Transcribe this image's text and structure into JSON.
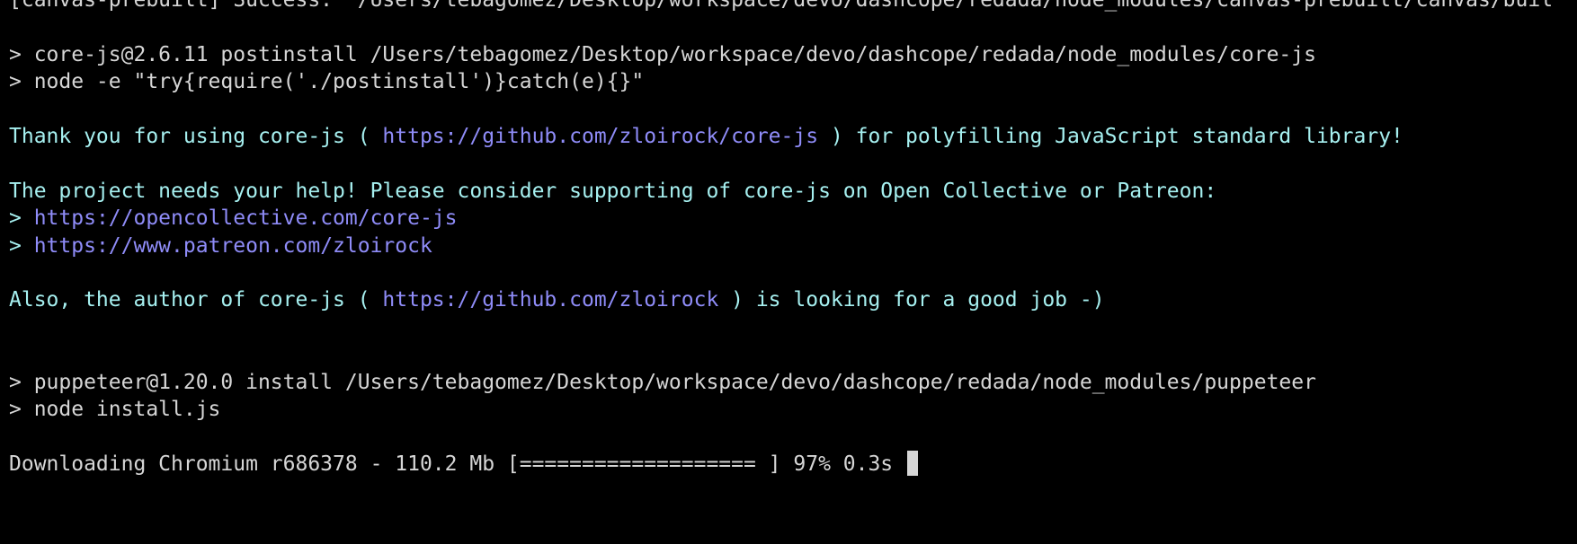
{
  "terminal": {
    "top_line": "[canvas-prebuilt] Success: \"/Users/tebagomez/Desktop/workspace/devo/dashcope/redada/node_modules/canvas-prebuilt/canvas/buil",
    "corejs_install": {
      "line1": "> core-js@2.6.11 postinstall /Users/tebagomez/Desktop/workspace/devo/dashcope/redada/node_modules/core-js",
      "line2": "> node -e \"try{require('./postinstall')}catch(e){}\""
    },
    "thanks": {
      "before": "Thank you for using core-js ( ",
      "link": "https://github.com/zloirock/core-js",
      "after": " ) for polyfilling JavaScript standard library!"
    },
    "help": {
      "text": "The project needs your help! Please consider supporting of core-js on Open Collective or Patreon:",
      "prompt": "> ",
      "link1": "https://opencollective.com/core-js",
      "link2": "https://www.patreon.com/zloirock"
    },
    "author": {
      "before": "Also, the author of core-js ( ",
      "link": "https://github.com/zloirock",
      "after": " ) is looking for a good job -)"
    },
    "puppeteer_install": {
      "line1": "> puppeteer@1.20.0 install /Users/tebagomez/Desktop/workspace/devo/dashcope/redada/node_modules/puppeteer",
      "line2": "> node install.js"
    },
    "download": {
      "text": "Downloading Chromium r686378 - 110.2 Mb [=================== ] 97% 0.3s ",
      "progress": 0.97
    },
    "colors": {
      "background": "#000000",
      "plain_text": "#d6d6d6",
      "cyan_text": "#a6f0f0",
      "link_text": "#8f8cf8"
    }
  }
}
